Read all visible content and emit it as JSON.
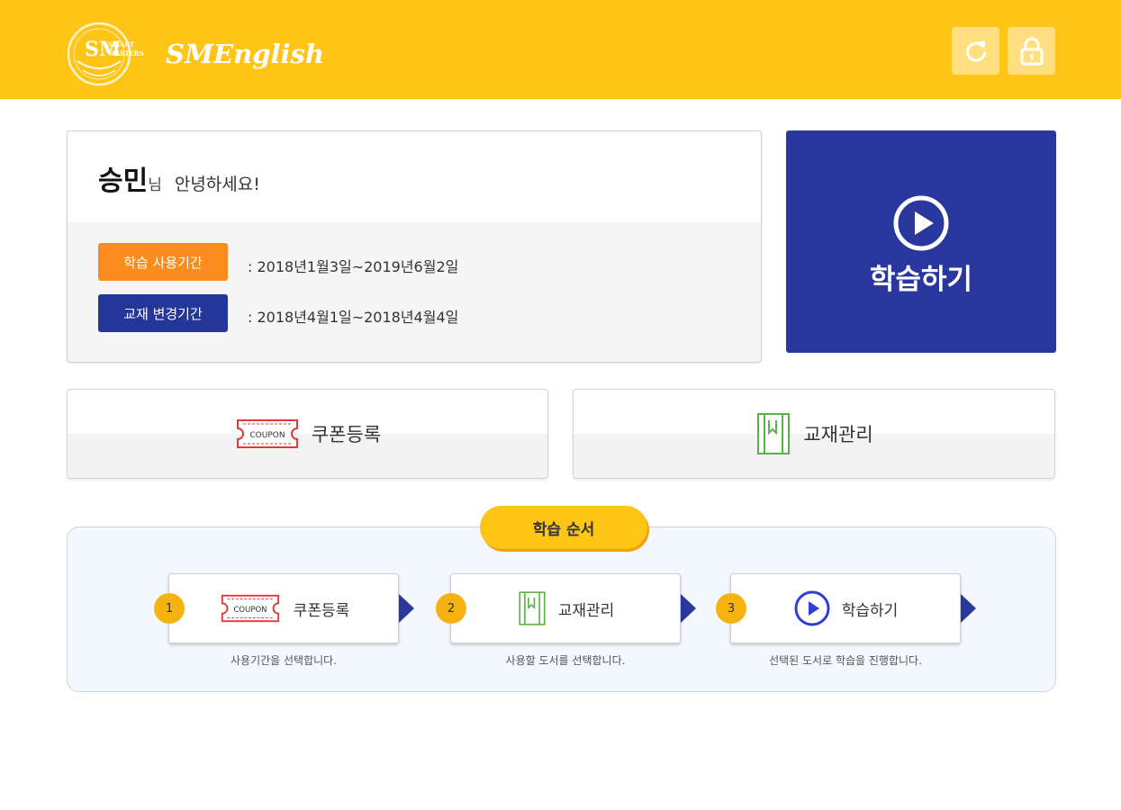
{
  "header": {
    "logo_text": "SMEnglish",
    "logo_seal_letters": "SM",
    "logo_seal_words": "SMART MASTERS",
    "refresh_icon": "refresh-icon",
    "lock_icon": "lock-icon"
  },
  "welcome": {
    "name": "승민",
    "honorific": "님",
    "greeting": "안녕하세요!",
    "study_period_label": "학습 사용기간",
    "study_period_value": ": 2018년1월3일~2019년6월2일",
    "book_change_label": "교재 변경기간",
    "book_change_value": ": 2018년4월1일~2018년4월4일"
  },
  "study_button": {
    "label": "학습하기",
    "icon": "play-circle-icon"
  },
  "actions": {
    "coupon": {
      "label": "쿠폰등록",
      "icon": "coupon-icon",
      "icon_text": "COUPON"
    },
    "books": {
      "label": "교재관리",
      "icon": "book-icon"
    }
  },
  "steps": {
    "title": "학습 순서",
    "items": [
      {
        "num": "1",
        "label": "쿠폰등록",
        "icon": "coupon-icon",
        "icon_text": "COUPON",
        "desc": "사용기간을 선택합니다."
      },
      {
        "num": "2",
        "label": "교재관리",
        "icon": "book-icon",
        "desc": "사용할 도서를 선택합니다."
      },
      {
        "num": "3",
        "label": "학습하기",
        "icon": "play-circle-icon",
        "desc": "선택된 도서로 학습을 진행합니다."
      }
    ]
  },
  "colors": {
    "header_yellow": "#ffc516",
    "navy": "#2a379e",
    "orange": "#f98c1d",
    "coupon_red": "#e0393e",
    "book_green": "#5bb14a"
  }
}
